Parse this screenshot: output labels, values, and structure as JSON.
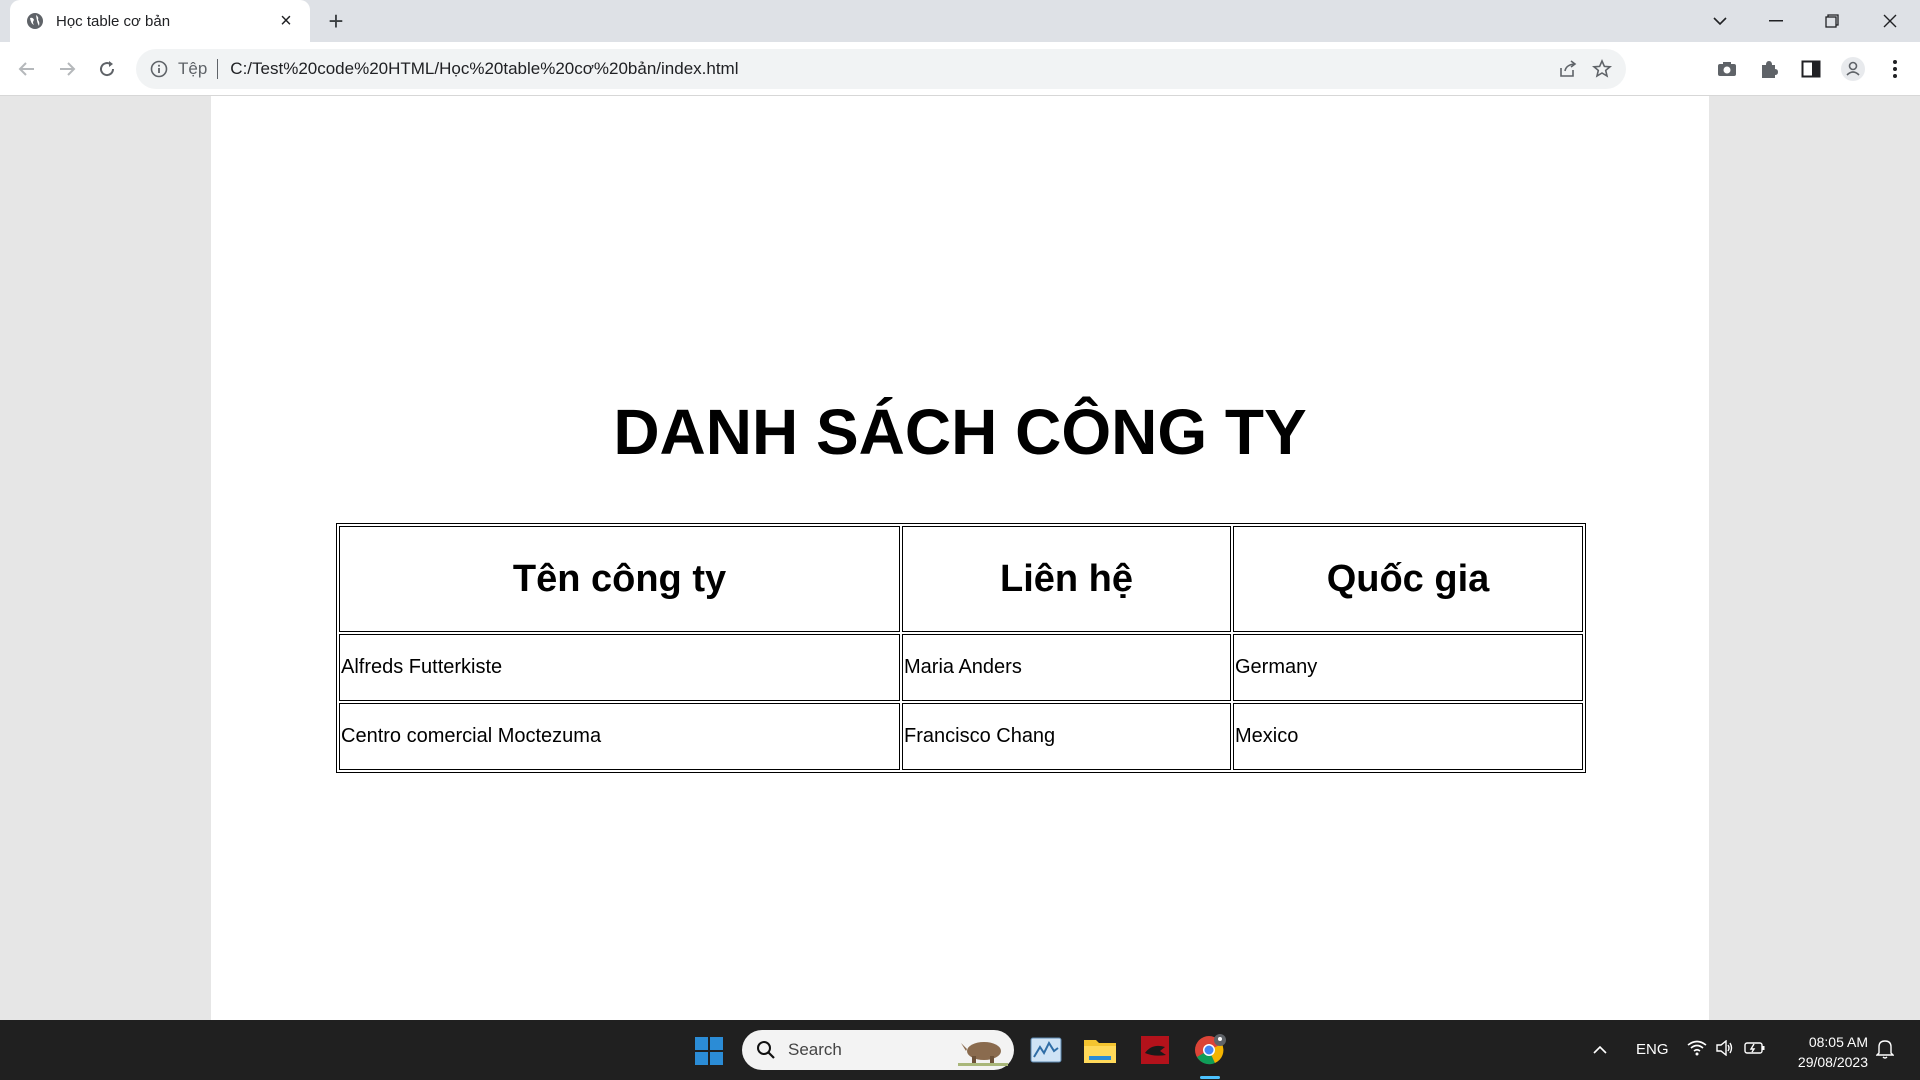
{
  "browser": {
    "tab_title": "Học table cơ bản",
    "new_tab_label": "+",
    "omnibox": {
      "scheme_label": "Tệp",
      "url": "C:/Test%20code%20HTML/Học%20table%20cơ%20bản/index.html"
    }
  },
  "page": {
    "heading": "DANH SÁCH CÔNG TY",
    "table": {
      "headers": [
        "Tên công ty",
        "Liên hệ",
        "Quốc gia"
      ],
      "rows": [
        [
          "Alfreds Futterkiste",
          "Maria Anders",
          "Germany"
        ],
        [
          "Centro comercial Moctezuma",
          "Francisco Chang",
          "Mexico"
        ]
      ]
    }
  },
  "taskbar": {
    "search_placeholder": "Search",
    "language": "ENG",
    "time": "08:05 AM",
    "date": "29/08/2023"
  },
  "colors": {
    "tabstrip": "#dee1e6",
    "taskbar": "#202020",
    "windows_blue": "#2b8cd6"
  }
}
